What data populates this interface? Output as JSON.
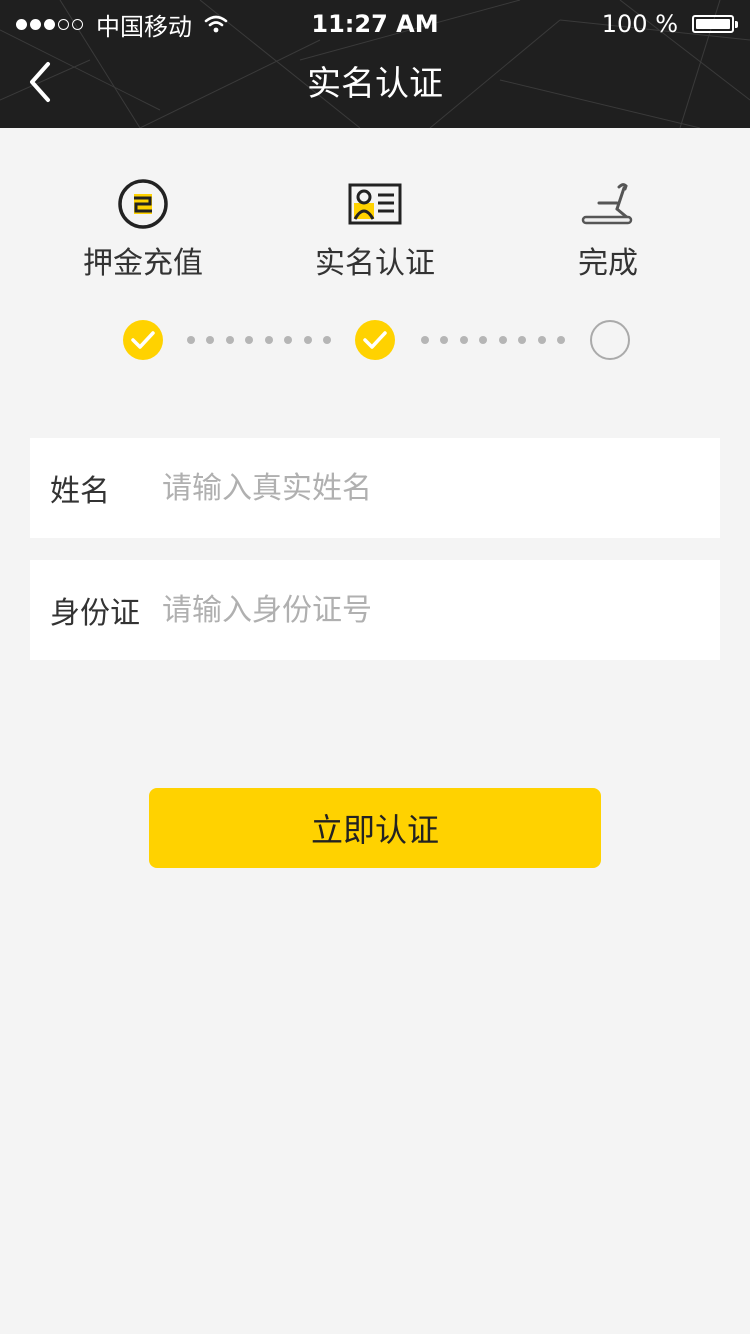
{
  "status_bar": {
    "carrier": "中国移动",
    "time": "11:27 AM",
    "battery": "100 %",
    "signal_bars": 3,
    "signal_total": 5
  },
  "nav": {
    "title": "实名认证",
    "back_icon": "chevron-left-icon"
  },
  "steps": [
    {
      "label": "押金充值",
      "icon": "deposit-coin-icon",
      "done": true
    },
    {
      "label": "实名认证",
      "icon": "id-card-icon",
      "done": true
    },
    {
      "label": "完成",
      "icon": "scooter-icon",
      "done": false
    }
  ],
  "form": {
    "name": {
      "label": "姓名",
      "placeholder": "请输入真实姓名",
      "value": ""
    },
    "id_card": {
      "label": "身份证",
      "placeholder": "请输入身份证号",
      "value": ""
    }
  },
  "submit_label": "立即认证",
  "colors": {
    "accent": "#ffd200",
    "header_bg": "#1f1f1f",
    "page_bg": "#f4f4f4"
  }
}
